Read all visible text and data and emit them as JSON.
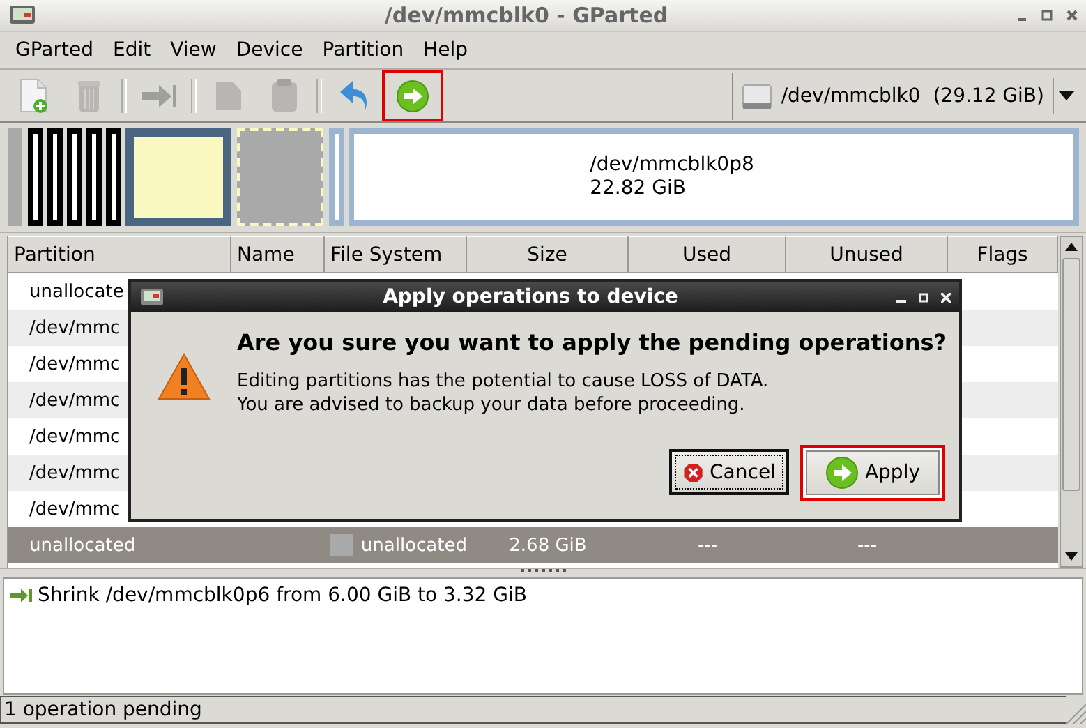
{
  "window": {
    "title": "/dev/mmcblk0 - GParted"
  },
  "menu": [
    "GParted",
    "Edit",
    "View",
    "Device",
    "Partition",
    "Help"
  ],
  "toolbar": {
    "groups": [
      [
        {
          "kind": "new",
          "disabled": false,
          "highlighted": false
        },
        {
          "kind": "delete",
          "disabled": true,
          "highlighted": false
        }
      ],
      [
        {
          "kind": "resize",
          "disabled": true,
          "highlighted": false
        }
      ],
      [
        {
          "kind": "copy",
          "disabled": true,
          "highlighted": false
        },
        {
          "kind": "paste",
          "disabled": true,
          "highlighted": false
        }
      ],
      [
        {
          "kind": "undo",
          "disabled": false,
          "highlighted": false
        },
        {
          "kind": "apply",
          "disabled": false,
          "highlighted": true
        }
      ]
    ]
  },
  "device": {
    "label": "/dev/mmcblk0  (29.12 GiB)"
  },
  "graph": {
    "segments": [
      {
        "kind": "unallocated",
        "selected": false
      },
      {
        "kind": "partition",
        "color": "#000000"
      },
      {
        "kind": "partition",
        "color": "#000000"
      },
      {
        "kind": "partition",
        "color": "#000000"
      },
      {
        "kind": "partition",
        "color": "#000000"
      },
      {
        "kind": "partition",
        "color": "#000000"
      },
      {
        "kind": "filled",
        "color": "#4a6580"
      },
      {
        "kind": "unallocated",
        "selected": true
      },
      {
        "kind": "partition",
        "color": "#9bb5d1"
      },
      {
        "kind": "partition",
        "color": "#9bb5d1",
        "name": "/dev/mmcblk0p8",
        "size": "22.82 GiB"
      }
    ]
  },
  "table": {
    "columns": [
      "Partition",
      "Name",
      "File System",
      "Size",
      "Used",
      "Unused",
      "Flags"
    ],
    "rows": [
      {
        "partition": "unallocate",
        "selected": false
      },
      {
        "partition": "/dev/mmc",
        "selected": false
      },
      {
        "partition": "/dev/mmc",
        "selected": false
      },
      {
        "partition": "/dev/mmc",
        "selected": false
      },
      {
        "partition": "/dev/mmc",
        "selected": false
      },
      {
        "partition": "/dev/mmc",
        "selected": false
      },
      {
        "partition": "/dev/mmc",
        "selected": false
      },
      {
        "partition": "unallocated",
        "file_system": "unallocated",
        "size": "2.68 GiB",
        "used": "---",
        "unused": "---",
        "selected": true
      }
    ]
  },
  "dialog": {
    "title": "Apply operations to device",
    "heading": "Are you sure you want to apply the pending operations?",
    "message": [
      "Editing partitions has the potential to cause LOSS of DATA.",
      "You are advised to backup your data before proceeding."
    ],
    "buttons": [
      {
        "kind": "cancel",
        "label": "Cancel",
        "focused": true,
        "highlighted": false
      },
      {
        "kind": "apply",
        "label": "Apply",
        "focused": false,
        "highlighted": true
      }
    ]
  },
  "operations": [
    {
      "kind": "resize",
      "text": "Shrink /dev/mmcblk0p6 from 6.00 GiB to 3.32 GiB"
    }
  ],
  "status_bar": "1 operation pending"
}
